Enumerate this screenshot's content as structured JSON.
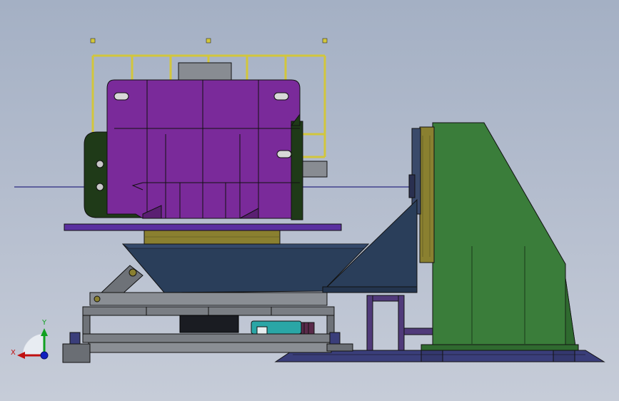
{
  "viewport": {
    "background_top": "#a4b0c4",
    "background_bottom": "#c6ccd8"
  },
  "axis_triad": {
    "x_label": "X",
    "y_label": "Y",
    "x_color": "#c01010",
    "y_color": "#10a020",
    "z_color": "#1020c0"
  },
  "model": {
    "components": [
      {
        "name": "railing",
        "color": "#d2c63c"
      },
      {
        "name": "workpiece-body",
        "color": "#7a2a9a"
      },
      {
        "name": "end-cap",
        "color": "#1f3a18"
      },
      {
        "name": "mounting-plate",
        "color": "#5a30a0"
      },
      {
        "name": "turntable-adapter",
        "color": "#8a8030"
      },
      {
        "name": "tilting-table",
        "color": "#2a3e5a"
      },
      {
        "name": "lift-frame",
        "color": "#6e7278"
      },
      {
        "name": "motor",
        "color": "#2aa6a6"
      },
      {
        "name": "headstock",
        "color": "#3a7d3a"
      },
      {
        "name": "base-rail",
        "color": "#3a3e7a"
      }
    ]
  }
}
